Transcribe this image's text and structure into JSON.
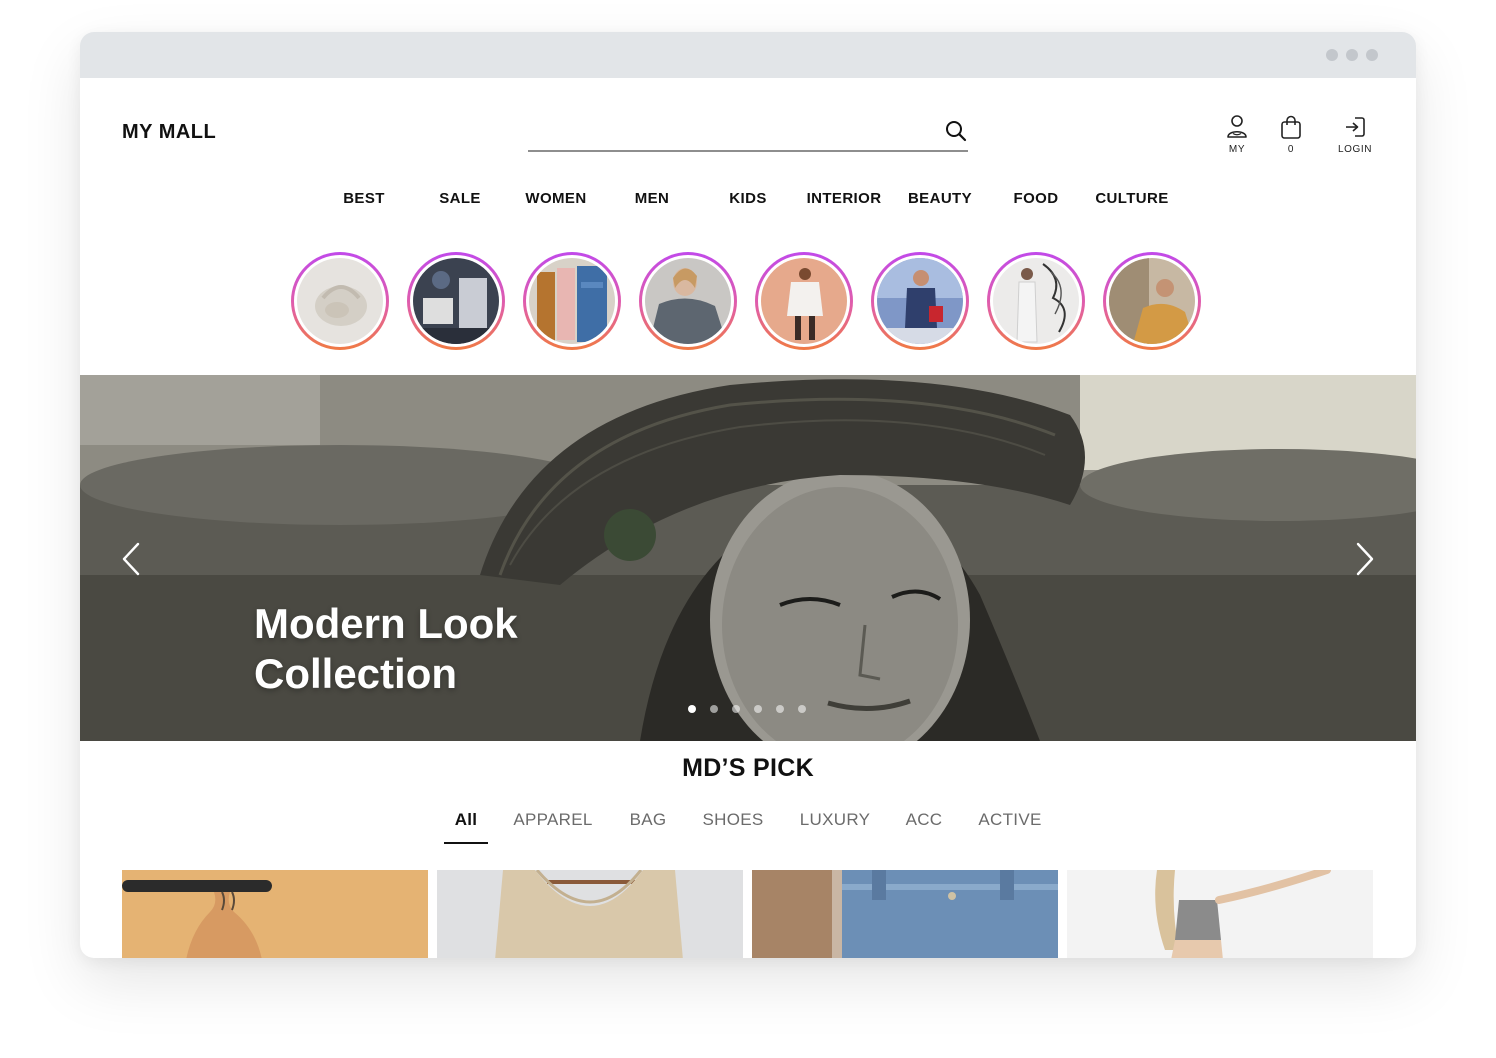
{
  "header": {
    "logo": "MY MALL",
    "search_placeholder": "",
    "util": {
      "my_label": "MY",
      "cart_count": "0",
      "login_label": "LOGIN"
    }
  },
  "nav": {
    "items": [
      "BEST",
      "SALE",
      "WOMEN",
      "MEN",
      "KIDS",
      "INTERIOR",
      "BEAUTY",
      "FOOD",
      "CULTURE"
    ]
  },
  "stories": {
    "count": 8
  },
  "hero": {
    "title_line1": "Modern Look",
    "title_line2": "Collection",
    "slide_count": 6,
    "active_slide": 1
  },
  "md_pick": {
    "title": "MD’S PICK",
    "tabs": [
      "All",
      "APPAREL",
      "BAG",
      "SHOES",
      "LUXURY",
      "ACC",
      "ACTIVE"
    ],
    "active_tab": "All"
  },
  "colors": {
    "story_ring_top": "#c149ea",
    "story_ring_bottom": "#f07a43",
    "titlebar": "#e2e5e8"
  }
}
